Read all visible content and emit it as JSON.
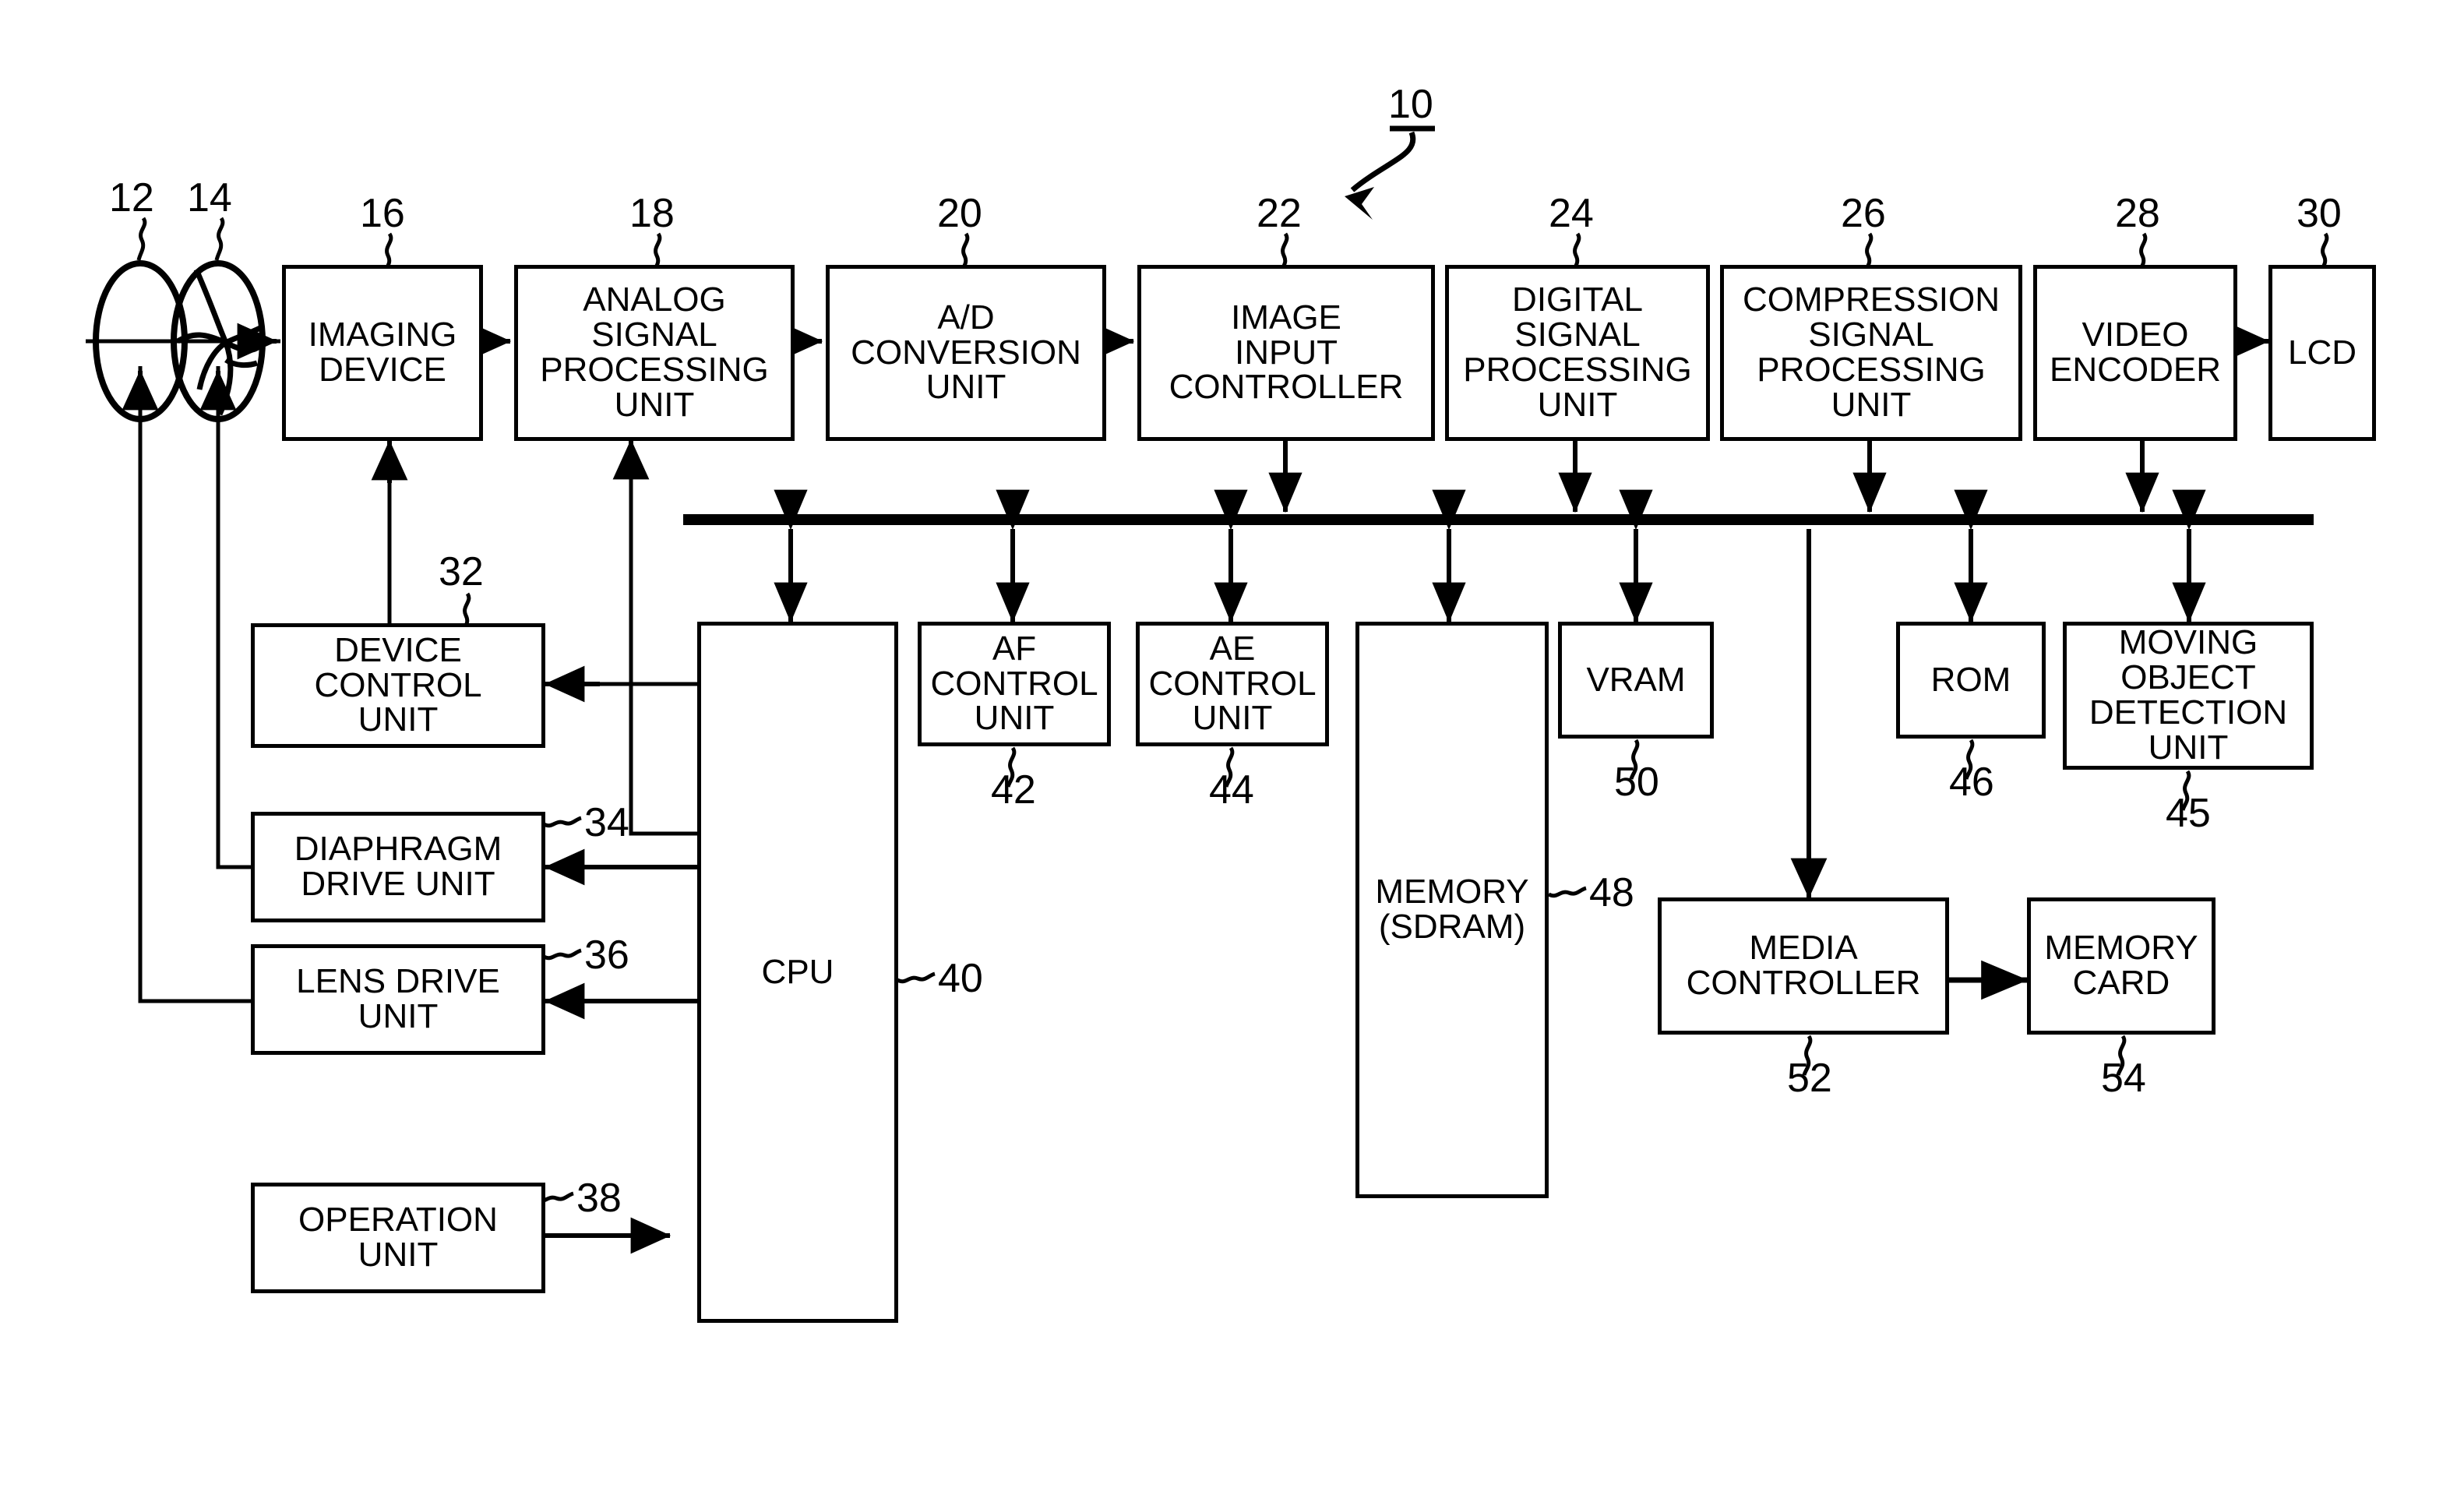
{
  "figure": {
    "main_ref": "10"
  },
  "blocks": [
    {
      "id": "imaging_device",
      "label": "IMAGING\nDEVICE",
      "ref": "16",
      "ref_pos": "top"
    },
    {
      "id": "analog_sp",
      "label": "ANALOG\nSIGNAL\nPROCESSING\nUNIT",
      "ref": "18",
      "ref_pos": "top"
    },
    {
      "id": "ad_conv",
      "label": "A/D\nCONVERSION\nUNIT",
      "ref": "20",
      "ref_pos": "top"
    },
    {
      "id": "image_input_ctrl",
      "label": "IMAGE\nINPUT\nCONTROLLER",
      "ref": "22",
      "ref_pos": "top"
    },
    {
      "id": "digital_sp",
      "label": "DIGITAL\nSIGNAL\nPROCESSING\nUNIT",
      "ref": "24",
      "ref_pos": "top"
    },
    {
      "id": "compression_sp",
      "label": "COMPRESSION\nSIGNAL\nPROCESSING\nUNIT",
      "ref": "26",
      "ref_pos": "top"
    },
    {
      "id": "video_encoder",
      "label": "VIDEO\nENCODER",
      "ref": "28",
      "ref_pos": "top"
    },
    {
      "id": "lcd",
      "label": "LCD",
      "ref": "30",
      "ref_pos": "top"
    },
    {
      "id": "device_ctrl",
      "label": "DEVICE\nCONTROL\nUNIT",
      "ref": "32",
      "ref_pos": "top"
    },
    {
      "id": "diaphragm_drive",
      "label": "DIAPHRAGM\nDRIVE UNIT",
      "ref": "34",
      "ref_pos": "right"
    },
    {
      "id": "lens_drive",
      "label": "LENS DRIVE\nUNIT",
      "ref": "36",
      "ref_pos": "right"
    },
    {
      "id": "operation_unit",
      "label": "OPERATION\nUNIT",
      "ref": "38",
      "ref_pos": "right"
    },
    {
      "id": "cpu",
      "label": "CPU",
      "ref": "40",
      "ref_pos": "right"
    },
    {
      "id": "af_ctrl",
      "label": "AF\nCONTROL\nUNIT",
      "ref": "42",
      "ref_pos": "bottom"
    },
    {
      "id": "ae_ctrl",
      "label": "AE\nCONTROL\nUNIT",
      "ref": "44",
      "ref_pos": "bottom"
    },
    {
      "id": "memory_sdram",
      "label": "MEMORY\n(SDRAM)",
      "ref": "48",
      "ref_pos": "right"
    },
    {
      "id": "vram",
      "label": "VRAM",
      "ref": "50",
      "ref_pos": "bottom"
    },
    {
      "id": "rom",
      "label": "ROM",
      "ref": "46",
      "ref_pos": "bottom"
    },
    {
      "id": "moving_object_det",
      "label": "MOVING\nOBJECT\nDETECTION\nUNIT",
      "ref": "45",
      "ref_pos": "bottom"
    },
    {
      "id": "media_controller",
      "label": "MEDIA\nCONTROLLER",
      "ref": "52",
      "ref_pos": "bottom"
    },
    {
      "id": "memory_card",
      "label": "MEMORY\nCARD",
      "ref": "54",
      "ref_pos": "bottom"
    }
  ],
  "optics": [
    {
      "id": "lens",
      "ref": "12",
      "kind": "lens-ellipse"
    },
    {
      "id": "diaphragm",
      "ref": "14",
      "kind": "diaphragm-iris"
    }
  ]
}
